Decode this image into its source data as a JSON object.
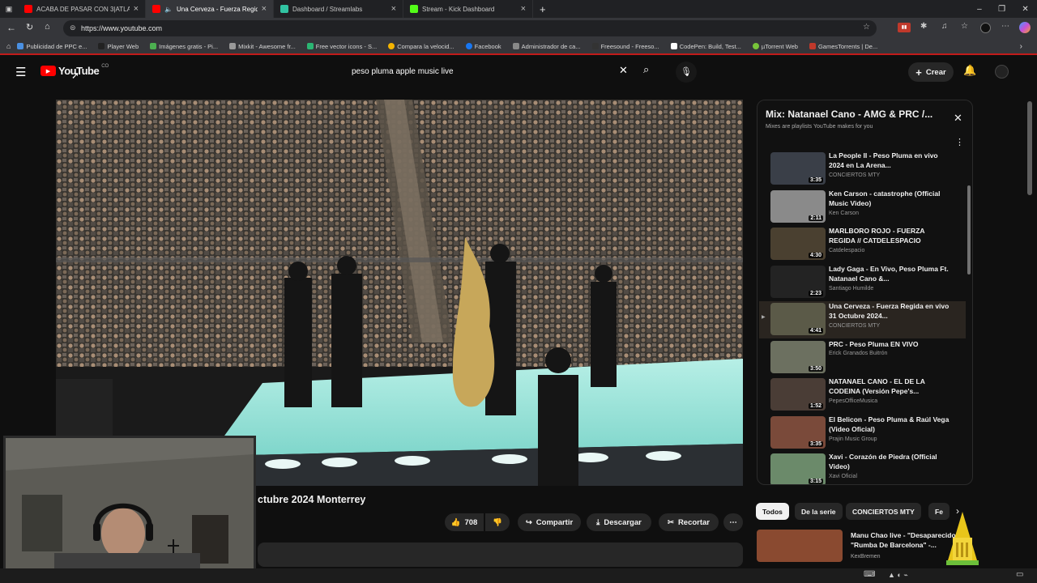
{
  "browser": {
    "tabs": [
      {
        "label": "ACABA DE PASAR CON 3|ATLAS",
        "color": "#ff0000",
        "active": false
      },
      {
        "label": "Una Cerveza - Fuerza Regid",
        "color": "#ff0000",
        "active": true
      },
      {
        "label": "Dashboard / Streamlabs",
        "color": "#31c3a2",
        "active": false
      },
      {
        "label": "Stream - Kick Dashboard",
        "color": "#53fc18",
        "active": false
      }
    ],
    "url": "https://www.youtube.com",
    "bookmarks": [
      "Publicidad de PPC e...",
      "Player Web",
      "Imágenes gratis - Pi...",
      "Mixkit - Awesome fr...",
      "Free vector icons - S...",
      "Compara la velocid...",
      "Facebook",
      "Administrador de ca...",
      "Freesound - Freeso...",
      "CodePen: Build, Test...",
      "µTorrent Web",
      "GamesTorrents | De..."
    ]
  },
  "youtube": {
    "logo_text": "YouTube",
    "logo_region": "CO",
    "search_query": "peso pluma apple music live",
    "create_label": "Crear"
  },
  "video": {
    "title_visible": "ctubre 2024 Monterrey",
    "likes": "708",
    "share_label": "Compartir",
    "download_label": "Descargar",
    "clip_label": "Recortar"
  },
  "playlist": {
    "title": "Mix: Natanael Cano - AMG & PRC /...",
    "subtitle": "Mixes are playlists YouTube makes for you",
    "items": [
      {
        "title": "La People II - Peso Pluma en vivo 2024 en La Arena...",
        "channel": "CONCIERTOS MTY",
        "duration": "3:35",
        "current": false,
        "thumb": "#3a3f48"
      },
      {
        "title": "Ken Carson - catastrophe (Official Music Video)",
        "channel": "Ken Carson",
        "duration": "2:11",
        "current": false,
        "thumb": "#8a8a8a"
      },
      {
        "title": "MARLBORO ROJO - FUERZA REGIDA // CATDELESPACIO",
        "channel": "Catdelespacio",
        "duration": "4:30",
        "current": false,
        "thumb": "#4a4030"
      },
      {
        "title": "Lady Gaga - En Vivo, Peso Pluma Ft. Natanael Cano &...",
        "channel": "Santiago Humilde",
        "duration": "2:23",
        "current": false,
        "thumb": "#232323"
      },
      {
        "title": "Una Cerveza - Fuerza Regida en vivo 31 Octubre 2024...",
        "channel": "CONCIERTOS MTY",
        "duration": "4:41",
        "current": true,
        "thumb": "#5b5a48"
      },
      {
        "title": "PRC - Peso Pluma EN VIVO",
        "channel": "Erick Granados Buitrón",
        "duration": "3:50",
        "current": false,
        "thumb": "#6c7060"
      },
      {
        "title": "NATANAEL CANO - EL DE LA CODEINA (Versión Pepe's...",
        "channel": "PepesOfficeMusica",
        "duration": "1:52",
        "current": false,
        "thumb": "#4a3d36"
      },
      {
        "title": "El Belicon - Peso Pluma & Raúl Vega (Video Oficial)",
        "channel": "Prajin Music Group",
        "duration": "3:35",
        "current": false,
        "thumb": "#7a4a3a"
      },
      {
        "title": "Xavi - Corazón de Piedra (Official Video)",
        "channel": "Xavi Oficial",
        "duration": "3:15",
        "current": false,
        "thumb": "#6b8a6a"
      }
    ]
  },
  "chips": [
    "Todos",
    "De la serie",
    "CONCIERTOS MTY",
    "Fe"
  ],
  "recommendation": {
    "title": "Manu Chao live - \"Desaparecido & \"Rumba De Barcelona\" -...",
    "channel": "KexBremen"
  }
}
